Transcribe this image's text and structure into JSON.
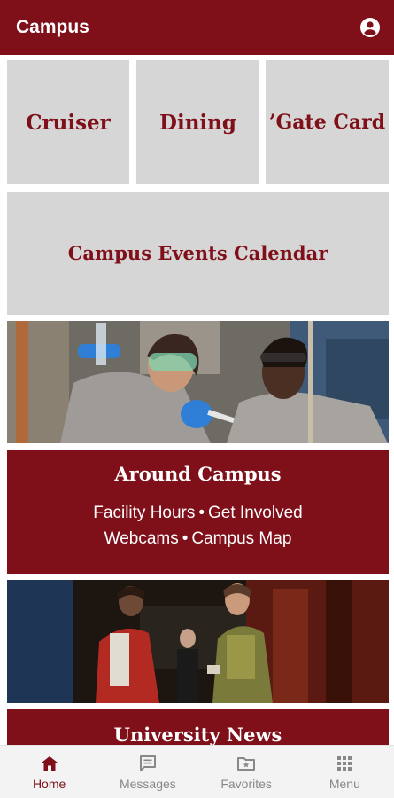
{
  "app_bar": {
    "title": "Campus",
    "account_icon": "account-circle-icon"
  },
  "tiles": {
    "cruiser": "Cruiser",
    "dining": "Dining",
    "gate_card": "’Gate Card",
    "events": "Campus Events Calendar"
  },
  "around_campus": {
    "title": "Around Campus",
    "links": [
      "Facility Hours",
      "Get Involved",
      "Webcams",
      "Campus Map"
    ],
    "separator": "•"
  },
  "news": {
    "title": "University News"
  },
  "bottom_nav": {
    "items": [
      {
        "label": "Home",
        "icon": "home-icon",
        "active": true
      },
      {
        "label": "Messages",
        "icon": "message-icon",
        "active": false
      },
      {
        "label": "Favorites",
        "icon": "folder-star-icon",
        "active": false
      },
      {
        "label": "Menu",
        "icon": "grid-icon",
        "active": false
      }
    ]
  },
  "colors": {
    "brand": "#7f1019",
    "tile": "#d6d6d6",
    "nav_inactive": "#888888"
  }
}
